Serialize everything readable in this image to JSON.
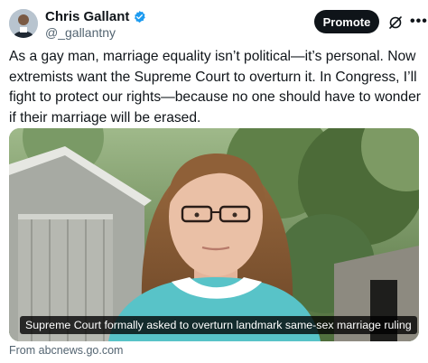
{
  "post": {
    "author_name": "Chris Gallant",
    "author_handle": "@_gallantny",
    "promote_label": "Promote",
    "more_label": "•••",
    "text": "As a gay man, marriage equality isn’t political—it’s personal. Now extremists want the Supreme Court to overturn it. In Congress, I’ll fight to protect our rights—because no one should have to wonder if their marriage will be erased."
  },
  "card": {
    "caption": "Supreme Court formally asked to overturn landmark same-sex marriage ruling",
    "source": "From abcnews.go.com"
  },
  "colors": {
    "text_primary": "#0f1419",
    "text_secondary": "#536471",
    "verified_blue": "#1d9bf0",
    "promote_bg": "#0f1419"
  },
  "icons": [
    "verified-badge-icon",
    "grok-icon",
    "more-icon"
  ]
}
